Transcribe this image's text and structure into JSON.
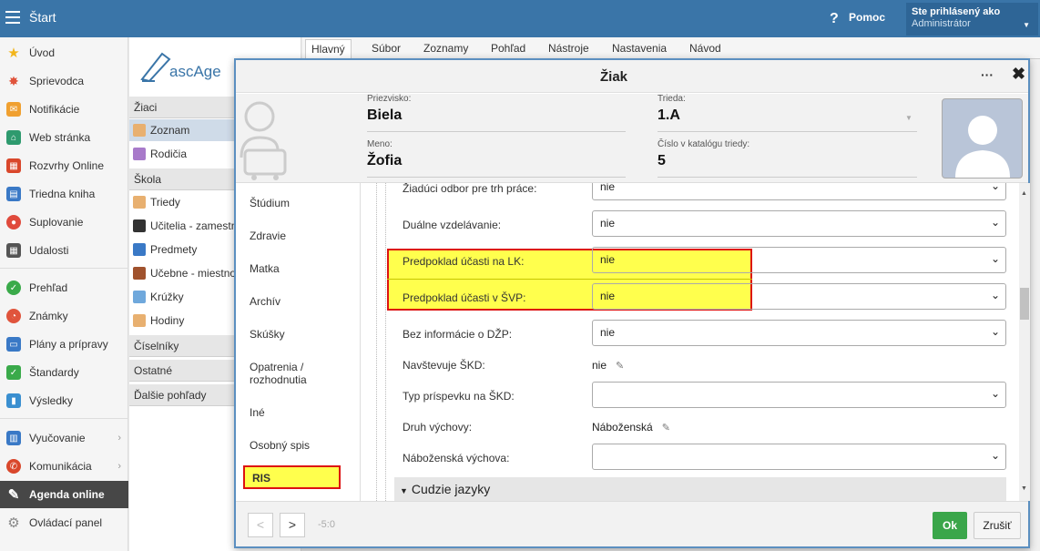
{
  "topbar": {
    "title": "Štart",
    "help_label": "Pomoc",
    "help_icon": "?",
    "user_line1": "Ste prihlásený ako",
    "user_line2": "Administrátor"
  },
  "leftnav": {
    "items": [
      {
        "label": "Úvod",
        "icon": "star-icon",
        "color": "#f2b51b"
      },
      {
        "label": "Sprievodca",
        "icon": "wand-icon",
        "color": "#e0543c"
      },
      {
        "label": "Notifikácie",
        "icon": "envelope-icon",
        "color": "#f0a030"
      },
      {
        "label": "Web stránka",
        "icon": "home-icon",
        "color": "#2e9a6e"
      },
      {
        "label": "Rozvrhy Online",
        "icon": "calendar-icon",
        "color": "#d9472b"
      },
      {
        "label": "Triedna kniha",
        "icon": "book-icon",
        "color": "#3a79c6"
      },
      {
        "label": "Suplovanie",
        "icon": "person-icon",
        "color": "#e04a3c"
      },
      {
        "label": "Udalosti",
        "icon": "calendar-grid-icon",
        "color": "#555555"
      },
      {
        "label": "Prehľad",
        "icon": "check-circle-icon",
        "color": "#3aaa4a"
      },
      {
        "label": "Známky",
        "icon": "chart-circle-icon",
        "color": "#e0543c"
      },
      {
        "label": "Plány a prípravy",
        "icon": "briefcase-icon",
        "color": "#3a79c6"
      },
      {
        "label": "Štandardy",
        "icon": "shield-check-icon",
        "color": "#3aaa4a"
      },
      {
        "label": "Výsledky",
        "icon": "bar-chart-icon",
        "color": "#3a8fd0"
      },
      {
        "label": "Vyučovanie",
        "icon": "book-open-icon",
        "color": "#3a79c6"
      },
      {
        "label": "Komunikácia",
        "icon": "chat-icon",
        "color": "#d9472b"
      },
      {
        "label": "Agenda online",
        "icon": "pen-icon",
        "color": "#ffffff"
      },
      {
        "label": "Ovládací panel",
        "icon": "gear-icon",
        "color": "#888888"
      }
    ]
  },
  "secondnav": {
    "logo_text": "ascAge",
    "sections": [
      {
        "label": "Žiaci"
      },
      {
        "label": "Škola"
      },
      {
        "label": "Číselníky"
      },
      {
        "label": "Ostatné"
      },
      {
        "label": "Ďalšie pohľady"
      }
    ],
    "items": [
      {
        "label": "Zoznam"
      },
      {
        "label": "Rodičia"
      },
      {
        "label": "Triedy"
      },
      {
        "label": "Učitelia - zamestn"
      },
      {
        "label": "Predmety"
      },
      {
        "label": "Učebne - miestno"
      },
      {
        "label": "Krúžky"
      },
      {
        "label": "Hodiny"
      }
    ]
  },
  "menubar": {
    "tabs": [
      "Hlavný",
      "Súbor",
      "Zoznamy",
      "Pohľad",
      "Nástroje",
      "Nastavenia",
      "Návod"
    ]
  },
  "modal": {
    "title": "Žiak",
    "more_label": "···",
    "close_label": "✖",
    "surname_label": "Priezvisko:",
    "surname": "Biela",
    "class_label": "Trieda:",
    "class_value": "1.A",
    "name_label": "Meno:",
    "name": "Žofia",
    "catalog_label": "Číslo v katalógu triedy:",
    "catalog_value": "5",
    "tabs": [
      "Štúdium",
      "Zdravie",
      "Matka",
      "Archív",
      "Skúšky",
      "Opatrenia / rozhodnutia",
      "Iné",
      "Osobný spis",
      "RIS"
    ],
    "fields": [
      {
        "label": "Žiadúci odbor pre trh práce:",
        "value": "nie"
      },
      {
        "label": "Duálne vzdelávanie:",
        "value": "nie"
      },
      {
        "label": "Predpoklad účasti na LK:",
        "value": "nie"
      },
      {
        "label": "Predpoklad účasti v ŠVP:",
        "value": "nie"
      },
      {
        "label": "Bez informácie o DŽP:",
        "value": "nie"
      },
      {
        "label": "Navštevuje ŠKD:",
        "value": "nie"
      },
      {
        "label": "Typ príspevku na ŠKD:",
        "value": ""
      },
      {
        "label": "Druh výchovy:",
        "value": "Náboženská"
      },
      {
        "label": "Náboženská výchova:",
        "value": ""
      }
    ],
    "subsection": "Cudzie jazyky",
    "counter": "-5:0",
    "prev_label": "<",
    "next_label": ">",
    "ok_label": "Ok",
    "cancel_label": "Zrušiť"
  }
}
